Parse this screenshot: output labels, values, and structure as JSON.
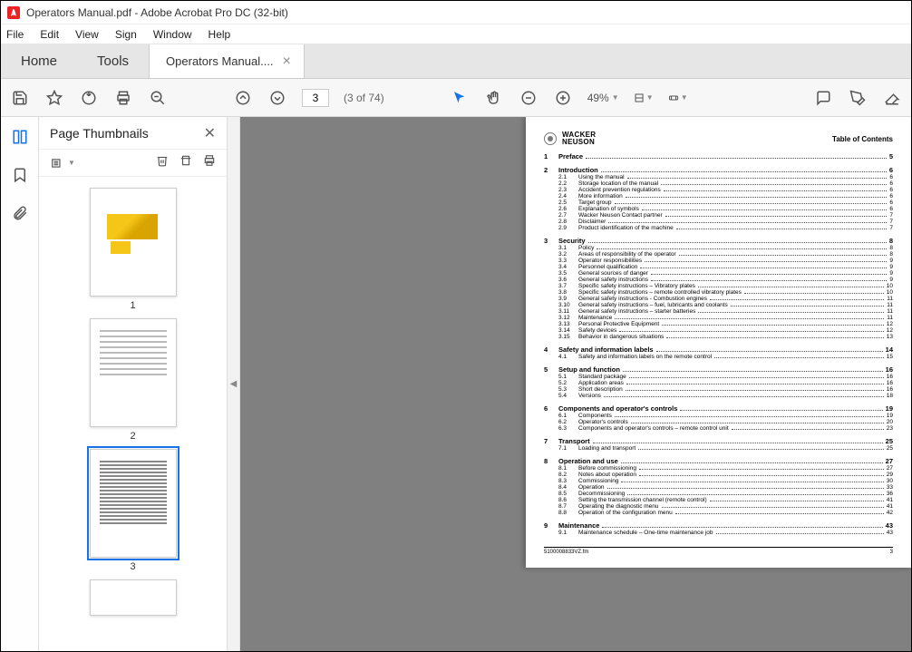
{
  "window": {
    "title": "Operators Manual.pdf - Adobe Acrobat Pro DC (32-bit)"
  },
  "menu": {
    "file": "File",
    "edit": "Edit",
    "view": "View",
    "sign": "Sign",
    "window": "Window",
    "help": "Help"
  },
  "tabs": {
    "home": "Home",
    "tools": "Tools",
    "doc": "Operators Manual...."
  },
  "paging": {
    "current": "3",
    "of": "(3 of 74)"
  },
  "zoom": {
    "level": "49%"
  },
  "thumb": {
    "title": "Page Thumbnails",
    "p1": "1",
    "p2": "2",
    "p3": "3"
  },
  "doc": {
    "brand1": "WACKER",
    "brand2": "NEUSON",
    "toc_title": "Table of Contents",
    "footer_left": "5100008833VZ.fm",
    "footer_right": "3",
    "sections": [
      {
        "n": "1",
        "t": "Preface",
        "p": "5",
        "subs": []
      },
      {
        "n": "2",
        "t": "Introduction",
        "p": "6",
        "subs": [
          {
            "n": "2.1",
            "t": "Using the manual",
            "p": "6"
          },
          {
            "n": "2.2",
            "t": "Storage location of the manual",
            "p": "6"
          },
          {
            "n": "2.3",
            "t": "Accident prevention regulations",
            "p": "6"
          },
          {
            "n": "2.4",
            "t": "More information",
            "p": "6"
          },
          {
            "n": "2.5",
            "t": "Target group",
            "p": "6"
          },
          {
            "n": "2.6",
            "t": "Explanation of symbols",
            "p": "6"
          },
          {
            "n": "2.7",
            "t": "Wacker Neuson Contact partner",
            "p": "7"
          },
          {
            "n": "2.8",
            "t": "Disclaimer",
            "p": "7"
          },
          {
            "n": "2.9",
            "t": "Product identification of the machine",
            "p": "7"
          }
        ]
      },
      {
        "n": "3",
        "t": "Security",
        "p": "8",
        "subs": [
          {
            "n": "3.1",
            "t": "Policy",
            "p": "8"
          },
          {
            "n": "3.2",
            "t": "Areas of responsibility of the operator",
            "p": "8"
          },
          {
            "n": "3.3",
            "t": "Operator responsibilities",
            "p": "9"
          },
          {
            "n": "3.4",
            "t": "Personnel qualification",
            "p": "9"
          },
          {
            "n": "3.5",
            "t": "General sources of danger",
            "p": "9"
          },
          {
            "n": "3.6",
            "t": "General safety instructions",
            "p": "9"
          },
          {
            "n": "3.7",
            "t": "Specific safety instructions – Vibratory plates",
            "p": "10"
          },
          {
            "n": "3.8",
            "t": "Specific safety instructions – remote controlled vibratory plates",
            "p": "10"
          },
          {
            "n": "3.9",
            "t": "General safety instructions - Combustion engines",
            "p": "11"
          },
          {
            "n": "3.10",
            "t": "General safety instructions – fuel, lubricants and coolants",
            "p": "11"
          },
          {
            "n": "3.11",
            "t": "General safety instructions – starter batteries",
            "p": "11"
          },
          {
            "n": "3.12",
            "t": "Maintenance",
            "p": "11"
          },
          {
            "n": "3.13",
            "t": "Personal Protective Equipment",
            "p": "12"
          },
          {
            "n": "3.14",
            "t": "Safety devices",
            "p": "12"
          },
          {
            "n": "3.15",
            "t": "Behavior in dangerous situations",
            "p": "13"
          }
        ]
      },
      {
        "n": "4",
        "t": "Safety and information labels",
        "p": "14",
        "subs": [
          {
            "n": "4.1",
            "t": "Safety and information labels on the remote control",
            "p": "15"
          }
        ]
      },
      {
        "n": "5",
        "t": "Setup and function",
        "p": "16",
        "subs": [
          {
            "n": "5.1",
            "t": "Standard package",
            "p": "16"
          },
          {
            "n": "5.2",
            "t": "Application areas",
            "p": "16"
          },
          {
            "n": "5.3",
            "t": "Short description",
            "p": "16"
          },
          {
            "n": "5.4",
            "t": "Versions",
            "p": "18"
          }
        ]
      },
      {
        "n": "6",
        "t": "Components and operator's controls",
        "p": "19",
        "subs": [
          {
            "n": "6.1",
            "t": "Components",
            "p": "19"
          },
          {
            "n": "6.2",
            "t": "Operator's controls",
            "p": "20"
          },
          {
            "n": "6.3",
            "t": "Components and operator's controls – remote control unit",
            "p": "23"
          }
        ]
      },
      {
        "n": "7",
        "t": "Transport",
        "p": "25",
        "subs": [
          {
            "n": "7.1",
            "t": "Loading and transport",
            "p": "25"
          }
        ]
      },
      {
        "n": "8",
        "t": "Operation and use",
        "p": "27",
        "subs": [
          {
            "n": "8.1",
            "t": "Before commissioning",
            "p": "27"
          },
          {
            "n": "8.2",
            "t": "Notes about operation",
            "p": "29"
          },
          {
            "n": "8.3",
            "t": "Commissioning",
            "p": "30"
          },
          {
            "n": "8.4",
            "t": "Operation",
            "p": "33"
          },
          {
            "n": "8.5",
            "t": "Decommissioning",
            "p": "36"
          },
          {
            "n": "8.6",
            "t": "Setting the transmission channel (remote control)",
            "p": "41"
          },
          {
            "n": "8.7",
            "t": "Operating the diagnostic menu",
            "p": "41"
          },
          {
            "n": "8.8",
            "t": "Operation of the configuration menu",
            "p": "42"
          }
        ]
      },
      {
        "n": "9",
        "t": "Maintenance",
        "p": "43",
        "subs": [
          {
            "n": "9.1",
            "t": "Maintenance schedule – One-time maintenance job",
            "p": "43"
          }
        ]
      }
    ]
  }
}
